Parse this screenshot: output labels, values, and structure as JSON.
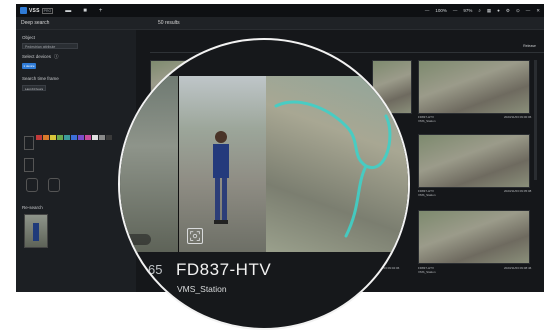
{
  "app": {
    "logo_text": "VSS",
    "logo_badge": "PRO"
  },
  "topbar": {
    "right_items": [
      "—",
      "100%",
      "—",
      "97%",
      "⌕",
      "▦",
      "●",
      "⚙",
      "⊙",
      "—",
      "✕"
    ]
  },
  "subbar": {
    "title": "Deep search",
    "results": "50 results"
  },
  "sidebar": {
    "object_label": "Object",
    "object_value": "Pedestrian attribute",
    "devices_label": "Select devices",
    "devices_button": "1 device",
    "timeframe_label": "Search time frame",
    "timeframe_button": "Last 24 hours",
    "research_label": "Re-search",
    "swatch_colors": [
      "#c23b3b",
      "#d97a2b",
      "#d8c43a",
      "#6aa84f",
      "#3c9b9b",
      "#3c6fd8",
      "#7b4cc9",
      "#c94c9b",
      "#e0e0e0",
      "#8a8a8a",
      "#3a3a3a"
    ]
  },
  "main": {
    "release_label": "Release",
    "thumbs": [
      {
        "id": "FD837-HTV",
        "site": "VMS_Station",
        "time": "2023/11/03 09:00:06"
      },
      {
        "id": "FD837-HTV",
        "site": "VMS_Station",
        "time": "2023/11/03 09:05:08"
      },
      {
        "id": "FD837-HTV",
        "site": "VMS_Station",
        "time": "2023/11/03 09:08:46"
      },
      {
        "id": "FD837-HTV",
        "site": "VMS_Station",
        "time": "2023/11/03 09:12:13"
      }
    ],
    "bottom_left_time": "2023/11/03 09:02:06"
  },
  "zoom": {
    "index_fragment": "65",
    "device_id": "FD837-HTV",
    "site": "VMS_Station"
  },
  "colors": {
    "accent": "#2f7bd6",
    "trail": "#3fd0c8"
  }
}
